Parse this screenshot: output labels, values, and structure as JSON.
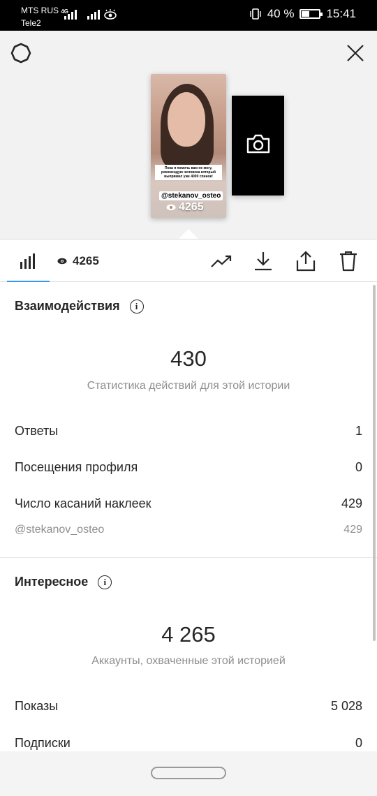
{
  "status_bar": {
    "carrier1": "MTS RUS",
    "network_type": "4G",
    "carrier2": "Tele2",
    "battery_percent": "40 %",
    "time": "15:41"
  },
  "preview": {
    "settings_icon": "gear-icon",
    "close_icon": "close-icon",
    "story_caption": "Пока я помочь вам не могу, рекомендую человека который выпрямил уже 4000 спинок!",
    "story_mention": "@stekanov_osteo",
    "story_views": "4265",
    "camera_icon": "camera-icon"
  },
  "toolbar": {
    "stats_icon": "bar-chart-icon",
    "views_count": "4265",
    "actions": [
      "trend-icon",
      "download-icon",
      "share-icon",
      "trash-icon"
    ]
  },
  "interactions": {
    "title": "Взаимодействия",
    "total": "430",
    "subtitle": "Статистика действий для этой истории",
    "rows": [
      {
        "label": "Ответы",
        "value": "1"
      },
      {
        "label": "Посещения профиля",
        "value": "0"
      },
      {
        "label": "Число касаний наклеек",
        "value": "429"
      }
    ],
    "sub_row": {
      "label": "@stekanov_osteo",
      "value": "429"
    }
  },
  "discovery": {
    "title": "Интересное",
    "total": "4 265",
    "subtitle": "Аккаунты, охваченные этой историей",
    "rows": [
      {
        "label": "Показы",
        "value": "5 028"
      },
      {
        "label": "Подписки",
        "value": "0"
      }
    ]
  },
  "colors": {
    "accent": "#3897f0",
    "text": "#262626",
    "muted": "#8e8e8e"
  }
}
